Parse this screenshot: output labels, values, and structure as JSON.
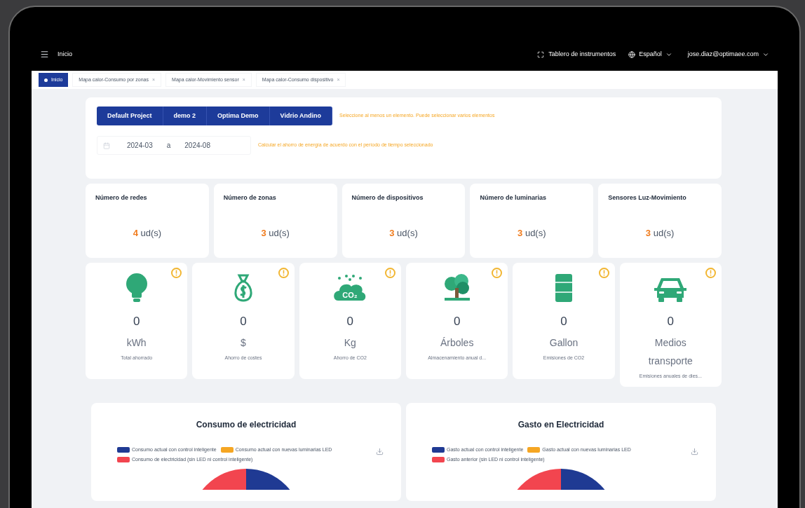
{
  "header": {
    "breadcrumb": "Inicio",
    "dashboard_link": "Tablero de instrumentos",
    "language": "Español",
    "user": "jose.diaz@optimaee.com"
  },
  "tabs": [
    {
      "label": "Inicio",
      "selected": true,
      "closable": false
    },
    {
      "label": "Mapa calor-Consumo por zonas",
      "selected": false,
      "closable": true,
      "close": "×"
    },
    {
      "label": "Mapa calor-Movimiento sensor",
      "selected": false,
      "closable": true,
      "close": "×"
    },
    {
      "label": "Mapa calor-Consumo dispositivo",
      "selected": false,
      "closable": true,
      "close": "×"
    }
  ],
  "filters": {
    "projects": [
      {
        "label": "Default Project",
        "selected": true
      },
      {
        "label": "demo 2",
        "selected": true
      },
      {
        "label": "Optima Demo",
        "selected": true
      },
      {
        "label": "Vidrio Andino",
        "selected": true
      }
    ],
    "projects_hint": "Seleccione al menos un elemento. Puede seleccionar varios elementos",
    "date_from": "2024-03",
    "date_separator": "a",
    "date_to": "2024-08",
    "date_hint": "Calcular el ahorro de energía de acuerdo con el período de tiempo seleccionado"
  },
  "stats": [
    {
      "label": "Número de redes",
      "value": "4",
      "unit": "ud(s)"
    },
    {
      "label": "Número de zonas",
      "value": "3",
      "unit": "ud(s)"
    },
    {
      "label": "Número de dispositivos",
      "value": "3",
      "unit": "ud(s)"
    },
    {
      "label": "Número de luminarias",
      "value": "3",
      "unit": "ud(s)"
    },
    {
      "label": "Sensores Luz-Movimiento",
      "value": "3",
      "unit": "ud(s)"
    }
  ],
  "impacts": [
    {
      "kind": "bulb",
      "value": "0",
      "unit": "kWh",
      "caption": "Total ahorrado"
    },
    {
      "kind": "money",
      "value": "0",
      "unit": "$",
      "caption": "Ahorro de costes"
    },
    {
      "kind": "co2",
      "icon_text": "CO₂",
      "value": "0",
      "unit": "Kg",
      "caption": "Ahorro de CO2"
    },
    {
      "kind": "tree",
      "value": "0",
      "unit": "Árboles",
      "caption": "Almacenamiento anual d..."
    },
    {
      "kind": "barrel",
      "value": "0",
      "unit": "Gallon",
      "caption": "Emisiones de CO2"
    },
    {
      "kind": "car",
      "value": "0",
      "unit": "Medios transporte",
      "caption": "Emisiones anuales de dies..."
    }
  ],
  "charts": [
    {
      "title": "Consumo de electricidad",
      "legend": [
        {
          "label": "Consumo actual con control inteligente",
          "color": "#1f3a93"
        },
        {
          "label": "Consumo actual con nuevas luminarias LED",
          "color": "#f5a623"
        },
        {
          "label": "Consumo de electricidad (sin LED ni control inteligente)",
          "color": "#f2454f"
        }
      ]
    },
    {
      "title": "Gasto en Electricidad",
      "legend": [
        {
          "label": "Gasto actual con control inteligente",
          "color": "#1f3a93"
        },
        {
          "label": "Gasto actual con nuevas luminarias LED",
          "color": "#f5a623"
        },
        {
          "label": "Gasto anterior (sin LED ni control inteligente)",
          "color": "#f2454f"
        }
      ]
    }
  ]
}
